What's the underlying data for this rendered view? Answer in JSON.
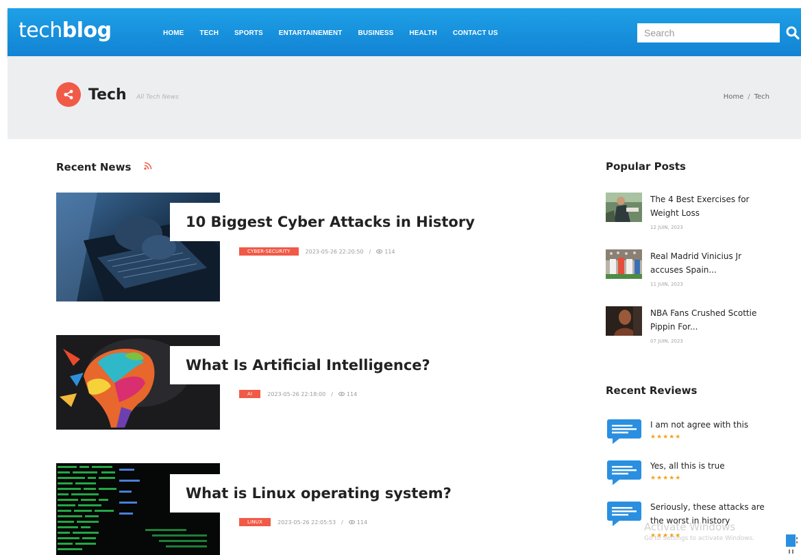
{
  "header": {
    "logo_light": "tech",
    "logo_bold": "blog",
    "nav": [
      "HOME",
      "TECH",
      "SPORTS",
      "ENTARTAINEMENT",
      "BUSINESS",
      "HEALTH",
      "CONTACT US"
    ],
    "search_placeholder": "Search",
    "accent_color": "#1a93dc"
  },
  "banner": {
    "title": "Tech",
    "subtitle": "All Tech News",
    "breadcrumb": [
      "Home",
      "Tech"
    ],
    "breadcrumb_separator": "/"
  },
  "recent_news": {
    "title": "Recent News",
    "icon": "rss-icon",
    "posts": [
      {
        "title": "10 Biggest Cyber Attacks in History",
        "tag": "CYBER-SECURITY",
        "date": "2023-05-26 22:20:50",
        "views": "114",
        "separator": "/"
      },
      {
        "title": "What Is Artificial Intelligence?",
        "tag": "AI",
        "date": "2023-05-26 22:18:00",
        "views": "114",
        "separator": "/"
      },
      {
        "title": "What is Linux operating system?",
        "tag": "LINUX",
        "date": "2023-05-26 22:05:53",
        "views": "114",
        "separator": "/"
      }
    ]
  },
  "popular_posts": {
    "title": "Popular Posts",
    "items": [
      {
        "title": "The 4 Best Exercises for Weight Loss",
        "date": "12 JUIN, 2023"
      },
      {
        "title": "Real Madrid Vinicius Jr accuses Spain...",
        "date": "11 JUIN, 2023"
      },
      {
        "title": "NBA Fans Crushed Scottie Pippin For...",
        "date": "07 JUIN, 2023"
      }
    ]
  },
  "recent_reviews": {
    "title": "Recent Reviews",
    "items": [
      {
        "text": "I am not agree with this",
        "stars": "★★★★★"
      },
      {
        "text": "Yes, all this is true",
        "stars": "★★★★★"
      },
      {
        "text": "Seriously, these attacks are the worst in history",
        "stars": "★★★★★"
      }
    ]
  },
  "watermark": {
    "line1": "Activate Windows",
    "line2": "Go to Settings to activate Windows."
  },
  "colors": {
    "tag_red": "#f05a47",
    "star_orange": "#f3a41a",
    "review_blue": "#2a8fe0"
  }
}
